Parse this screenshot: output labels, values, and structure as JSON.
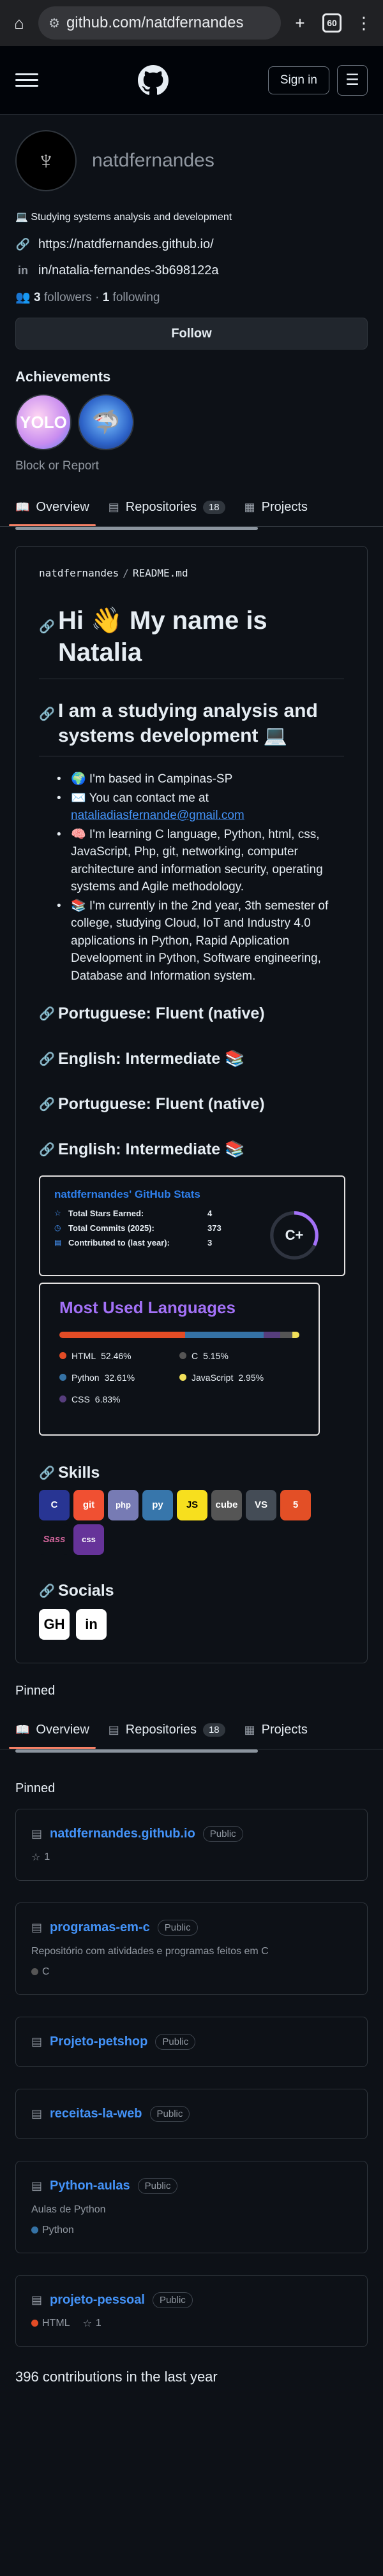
{
  "browser": {
    "url": "github.com/natdfernandes",
    "tab_count": "60"
  },
  "header": {
    "signin_label": "Sign in"
  },
  "profile": {
    "username": "natdfernandes",
    "bio": "💻 Studying systems analysis and development",
    "website": "https://natdfernandes.github.io/",
    "linkedin": "in/natalia-fernandes-3b698122a",
    "followers_count": "3",
    "followers_label": "followers",
    "following_count": "1",
    "following_label": "following",
    "follow_label": "Follow",
    "achievements_title": "Achievements",
    "block_report": "Block or Report"
  },
  "tabs": [
    {
      "label": "Overview",
      "icon": "book-icon"
    },
    {
      "label": "Repositories",
      "count": "18",
      "icon": "repo-icon"
    },
    {
      "label": "Projects",
      "icon": "table-icon"
    }
  ],
  "readme": {
    "path_user": "natdfernandes",
    "path_file": "README.md",
    "heading": "Hi 👋 My name is Natalia",
    "subheading": "I am a studying analysis and systems development 💻",
    "bullets": [
      "🌍 I'm based in Campinas-SP",
      "✉️ You can contact me at",
      "🧠 I'm learning C language, Python, html, css, JavaScript, Php, git, networking, computer architecture and information security, operating systems and Agile methodology.",
      "📚 I'm currently in the 2nd year, 3th semester of college, studying Cloud, IoT and Industry 4.0 applications in Python, Rapid Application Development in Python, Software engineering, Database and Information system."
    ],
    "email": "nataliadiasfernande@gmail.com",
    "languages": [
      "Portuguese: Fluent (native)",
      "English: Intermediate 📚",
      "Portuguese: Fluent (native)",
      "English: Intermediate 📚"
    ],
    "stats": {
      "title": "natdfernandes' GitHub Stats",
      "rows": [
        {
          "label": "Total Stars Earned:",
          "value": "4"
        },
        {
          "label": "Total Commits (2025):",
          "value": "373"
        },
        {
          "label": "Contributed to (last year):",
          "value": "3"
        }
      ],
      "grade": "C+"
    },
    "top_langs": {
      "title": "Most Used Languages",
      "items": [
        {
          "name": "HTML",
          "percent": "52.46%",
          "color": "#e34c26"
        },
        {
          "name": "C",
          "percent": "5.15%",
          "color": "#555555"
        },
        {
          "name": "Python",
          "percent": "32.61%",
          "color": "#3572a5"
        },
        {
          "name": "JavaScript",
          "percent": "2.95%",
          "color": "#f1e05a"
        },
        {
          "name": "CSS",
          "percent": "6.83%",
          "color": "#563d7c"
        }
      ]
    },
    "skills_title": "Skills",
    "skills": [
      "C",
      "git",
      "php",
      "py",
      "JS",
      "cube",
      "VS",
      "5",
      "Sass",
      "css"
    ],
    "socials_title": "Socials",
    "socials": [
      "GH",
      "in"
    ]
  },
  "pinned_label": "Pinned",
  "pinned": [
    {
      "name": "natdfernandes.github.io",
      "badge": "Public",
      "desc": "",
      "lang": "",
      "lang_color": "",
      "stars": "1"
    },
    {
      "name": "programas-em-c",
      "badge": "Public",
      "desc": "Repositório com atividades e programas feitos em C",
      "lang": "C",
      "lang_color": "#555555",
      "stars": ""
    },
    {
      "name": "Projeto-petshop",
      "badge": "Public",
      "desc": "",
      "lang": "",
      "lang_color": "",
      "stars": ""
    },
    {
      "name": "receitas-la-web",
      "badge": "Public",
      "desc": "",
      "lang": "",
      "lang_color": "",
      "stars": ""
    },
    {
      "name": "Python-aulas",
      "badge": "Public",
      "desc": "Aulas de Python",
      "lang": "Python",
      "lang_color": "#3572a5",
      "stars": ""
    },
    {
      "name": "projeto-pessoal",
      "badge": "Public",
      "desc": "",
      "lang": "HTML",
      "lang_color": "#e34c26",
      "stars": "1"
    }
  ],
  "contributions": "396 contributions in the last year"
}
